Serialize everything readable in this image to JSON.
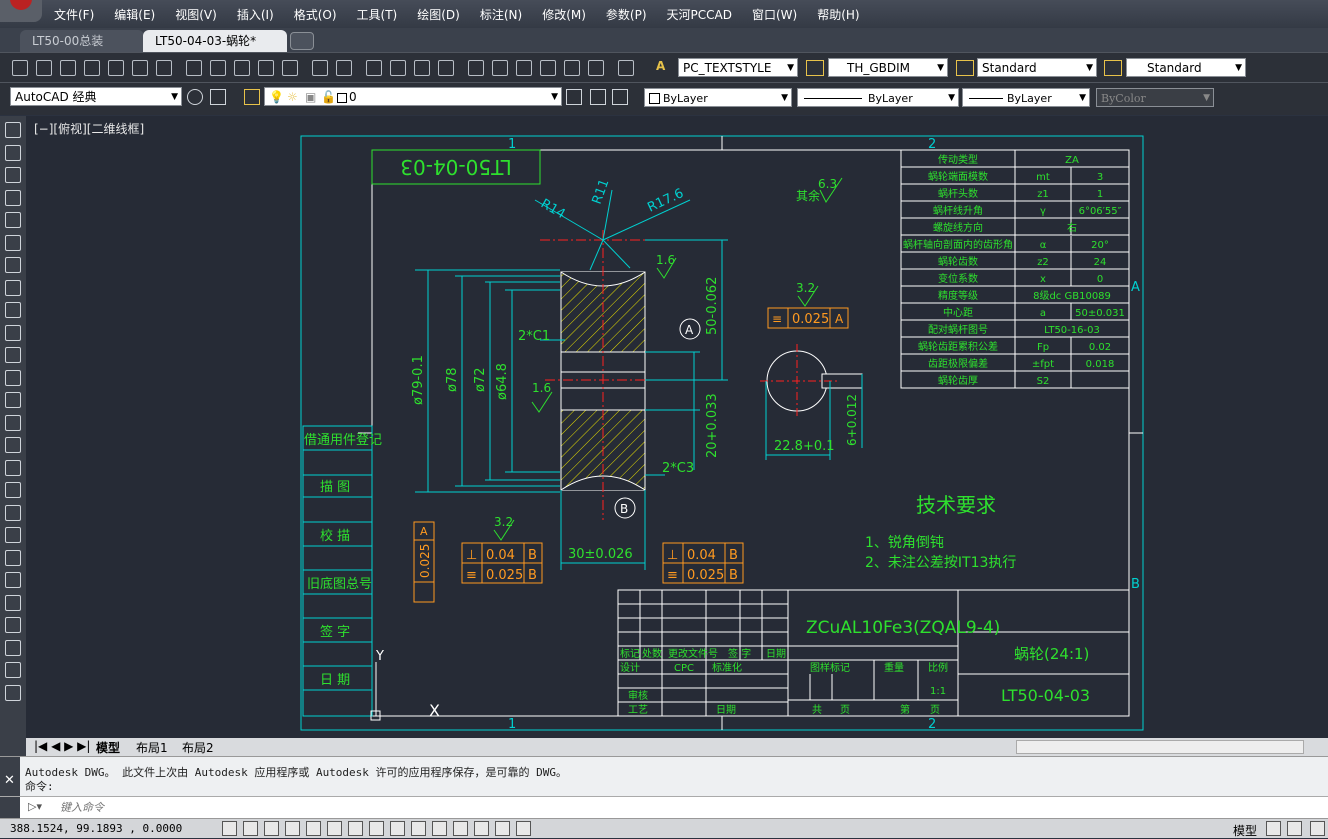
{
  "menu": [
    "文件(F)",
    "编辑(E)",
    "视图(V)",
    "插入(I)",
    "格式(O)",
    "工具(T)",
    "绘图(D)",
    "标注(N)",
    "修改(M)",
    "参数(P)",
    "天河PCCAD",
    "窗口(W)",
    "帮助(H)"
  ],
  "tabs": [
    {
      "label": "LT50-00总装"
    },
    {
      "label": "LT50-04-03-蜗轮*"
    }
  ],
  "toolbar1": {
    "textstyle": "PC_TEXTSTYLE",
    "dimstyle": "TH_GBDIM",
    "tablestyle": "Standard",
    "mlstyle": "Standard"
  },
  "toolbar2": {
    "workspace": "AutoCAD 经典",
    "layer": "0",
    "color": "ByLayer",
    "linetype": "ByLayer",
    "lineweight": "ByLayer",
    "plotstyle": "ByColor"
  },
  "viewport_label": "[−][俯视][二维线框]",
  "drawing": {
    "part_code_mirrored": "LT50-04-03",
    "zone_top": [
      "1",
      "2"
    ],
    "zone_bottom": [
      "1",
      "2"
    ],
    "zone_right": [
      "A",
      "B"
    ],
    "radii": [
      "R14",
      "R11",
      "R17.6"
    ],
    "rough_other": "其余",
    "rough_other_val": "6.3",
    "rough_a": "1.6",
    "rough_b": "1.6",
    "rough_c": "3.2",
    "rough_d": "3.2",
    "chamfer1": "2*C1",
    "chamfer2": "2*C3",
    "datum_a": "A",
    "datum_b": "B",
    "dim_50": "50-0.062",
    "dim_20": "20+0.033",
    "dim_79": "ø79-0.1",
    "dim_78": "ø78",
    "dim_72": "ø72",
    "dim_648": "ø64.8",
    "dim_30": "30±0.026",
    "dim_228": "22.8+0.1",
    "dim_6": "6+0.012",
    "tol_hub": "0.025",
    "tol_left_sym": "0.025",
    "tol_left_a": "A",
    "fcf_left": [
      {
        "sym": "⊥",
        "val": "0.04",
        "ref": "B"
      },
      {
        "sym": "≡",
        "val": "0.025",
        "ref": "B"
      }
    ],
    "fcf_right": [
      {
        "sym": "⊥",
        "val": "0.04",
        "ref": "B"
      },
      {
        "sym": "≡",
        "val": "0.025",
        "ref": "B"
      }
    ],
    "side_labels": [
      "借通用件登记",
      "描  图",
      "校  描",
      "旧底图总号",
      "签  字",
      "日  期"
    ],
    "tech_title": "技术要求",
    "tech_items": [
      "1、锐角倒钝",
      "2、未注公差按IT13执行"
    ],
    "params": [
      [
        "传动类型",
        "",
        "ZA"
      ],
      [
        "蜗轮端面模数",
        "mt",
        "3"
      ],
      [
        "蜗杆头数",
        "z1",
        "1"
      ],
      [
        "蜗杆线升角",
        "γ",
        "6°06′55″"
      ],
      [
        "螺旋线方向",
        "",
        "右"
      ],
      [
        "蜗杆轴向剖面内的齿形角",
        "α",
        "20°"
      ],
      [
        "蜗轮齿数",
        "z2",
        "24"
      ],
      [
        "变位系数",
        "x",
        "0"
      ],
      [
        "精度等级",
        "",
        "8级dc GB10089"
      ],
      [
        "中心距",
        "a",
        "50±0.031"
      ],
      [
        "配对蜗杆图号",
        "",
        "LT50-16-03"
      ],
      [
        "蜗轮齿距累积公差",
        "Fp",
        "0.02"
      ],
      [
        "齿距极限偏差",
        "±fpt",
        "0.018"
      ],
      [
        "蜗轮齿厚",
        "S2",
        ""
      ]
    ],
    "title_block": {
      "material": "ZCuAL10Fe3(ZQAL9-4)",
      "name": "蜗轮(24:1)",
      "code": "LT50-04-03",
      "r1": [
        "标记",
        "处数",
        "更改文件号",
        "签 字",
        "日期"
      ],
      "r2": [
        "设计",
        "CPC",
        "标准化"
      ],
      "stage_hdr": [
        "图样标记",
        "重量",
        "比例"
      ],
      "scale": "1:1",
      "r3": [
        "审核"
      ],
      "r4": [
        "工艺",
        "日期",
        "共",
        "页",
        "第",
        "页"
      ]
    },
    "ucs_y": "Y",
    "ucs_x": "X"
  },
  "layout_tabs": [
    "模型",
    "布局1",
    "布局2"
  ],
  "command": {
    "line1": "Autodesk DWG。  此文件上次由 Autodesk 应用程序或 Autodesk 许可的应用程序保存，是可靠的 DWG。",
    "line2": "命令:",
    "placeholder": "键入命令"
  },
  "status": {
    "coords": "388.1524, 99.1893 , 0.0000",
    "model": "模型"
  },
  "colors": {
    "frame": "#00d0d0",
    "hatch": "#e8e000",
    "title_line": "#ffffff",
    "centerline": "#ff2020",
    "green": "#2ee02e",
    "orange": "#ff9a20"
  }
}
